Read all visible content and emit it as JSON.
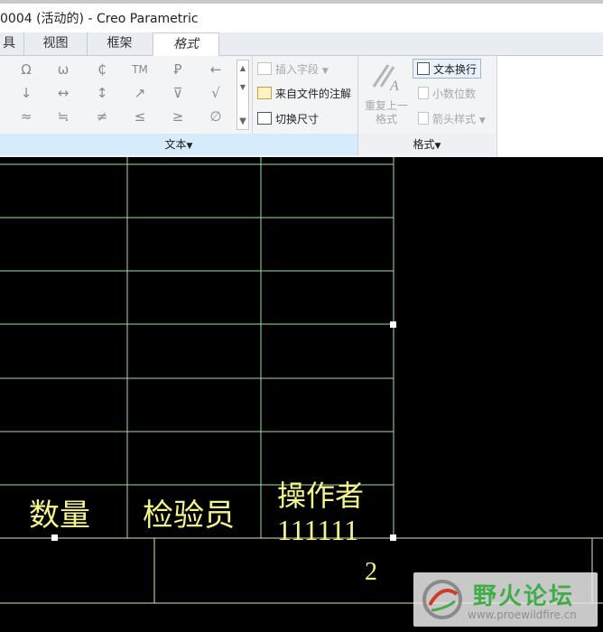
{
  "window": {
    "title": "0004 (活动的) - Creo Parametric"
  },
  "tabs": [
    {
      "label": "具",
      "active": false
    },
    {
      "label": "视图",
      "active": false
    },
    {
      "label": "框架",
      "active": false
    },
    {
      "label": "格式",
      "active": true
    }
  ],
  "symbols": [
    [
      "Ω",
      "ω",
      "₵",
      "TM",
      "Ꝑ",
      "←"
    ],
    [
      "↓",
      "↔",
      "↕",
      "↗",
      "⊽",
      "√"
    ],
    [
      "≈",
      "≒",
      "≠",
      "≤",
      "≥",
      "∅"
    ]
  ],
  "text_group": {
    "label": "文本",
    "commands": {
      "insert_field": "插入字段",
      "from_file_note": "来自文件的注解",
      "toggle_dimension": "切换尺寸"
    }
  },
  "format_group": {
    "label": "格式",
    "repeat_format": "重复上一格式",
    "text_wrap": "文本换行",
    "decimal_places": "小数位数",
    "arrow_style": "箭头样式"
  },
  "drawing": {
    "cells": {
      "quantity": "数量",
      "inspector": "检验员",
      "operator": "操作者",
      "operator_value": "111111",
      "sheet_value": "2"
    },
    "colors": {
      "text": "#f5f58a",
      "table_line": "#e6e6a0",
      "selected_line": "#9be09b",
      "background": "#000000"
    }
  },
  "watermark": {
    "title": "野火论坛",
    "url": "www.proewildfire.cn"
  }
}
